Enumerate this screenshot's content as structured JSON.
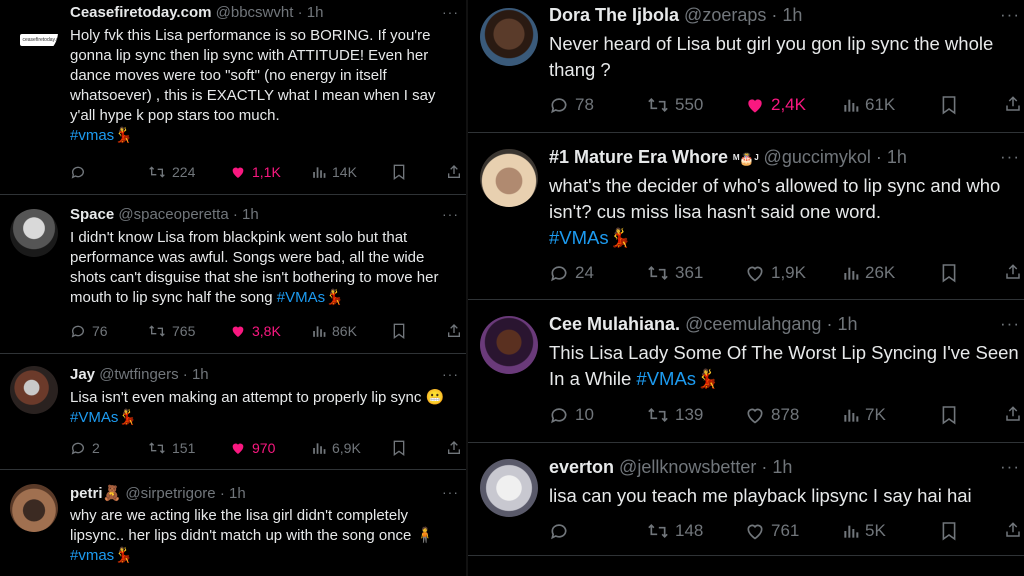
{
  "left_tweets": [
    {
      "name": "Ceasefiretoday.com",
      "handle": "@bbcswvht",
      "time": "· 1h",
      "avatar_label": "ceasefiretoday.com",
      "text": "Holy fvk this Lisa performance is so BORING. If you're gonna lip sync then lip sync with ATTITUDE! Even her dance moves were too \"soft\" (no energy in itself whatsoever) , this is EXACTLY what I mean when I say y'all hype k pop stars too much.",
      "hashtag": "#vmas",
      "replies": "",
      "reposts": "224",
      "likes": "1,1K",
      "views": "14K"
    },
    {
      "name": "Space",
      "handle": "@spaceoperetta",
      "time": "· 1h",
      "text": "I didn't know Lisa from blackpink went solo but that performance was awful. Songs were bad, all the wide shots can't disguise that she isn't bothering to move her mouth to lip sync half the song",
      "hashtag": "#VMAs",
      "replies": "76",
      "reposts": "765",
      "likes": "3,8K",
      "views": "86K"
    },
    {
      "name": "Jay",
      "handle": "@twtfingers",
      "time": "· 1h",
      "text": "Lisa isn't even making an attempt to properly lip sync",
      "emoji": "😬",
      "hashtag": "#VMAs",
      "replies": "2",
      "reposts": "151",
      "likes": "970",
      "views": "6,9K"
    },
    {
      "name": "petri",
      "name_emoji": "🧸",
      "handle": "@sirpetrigore",
      "time": "· 1h",
      "text": "why are we acting like the lisa girl didn't completely lipsync.. her lips didn't match up with the song once",
      "emoji": "🧍",
      "hashtag": "#vmas"
    }
  ],
  "right_tweets": [
    {
      "name": "Dora The Ijbola",
      "handle": "@zoeraps",
      "time": "· 1h",
      "text": "Never heard of Lisa but girl you gon lip sync the whole thang ?",
      "replies": "78",
      "reposts": "550",
      "likes": "2,4K",
      "views": "61K"
    },
    {
      "name": "#1 Mature Era Whore",
      "name_suffix": "ᴹ🎂ᴶ",
      "handle": "@guccimykol",
      "time": "· 1h",
      "text": "what's the decider of who's allowed to lip sync and who isn't? cus miss lisa hasn't said one word.",
      "hashtag": "#VMAs",
      "replies": "24",
      "reposts": "361",
      "likes": "1,9K",
      "views": "26K"
    },
    {
      "name": "Cee Mulahiana.",
      "handle": "@ceemulahgang",
      "time": "· 1h",
      "text": "This Lisa Lady Some Of The Worst Lip Syncing I've Seen In a While",
      "hashtag": "#VMAs",
      "replies": "10",
      "reposts": "139",
      "likes": "878",
      "views": "7K"
    },
    {
      "name": "everton",
      "handle": "@jellknowsbetter",
      "time": "· 1h",
      "text": "lisa can you teach me playback lipsync I say hai hai",
      "replies": "",
      "reposts": "148",
      "likes": "761",
      "views": "5K"
    }
  ],
  "colors": {
    "background": "#000000",
    "text": "#e7e9ea",
    "muted": "#71767b",
    "hashtag": "#1d9bf0",
    "like": "#f91880",
    "divider": "#2f3336"
  },
  "icons": [
    "reply-icon",
    "repost-icon",
    "like-icon",
    "views-icon",
    "bookmark-icon",
    "share-icon",
    "more-icon",
    "hashtag-emoji-icon"
  ]
}
